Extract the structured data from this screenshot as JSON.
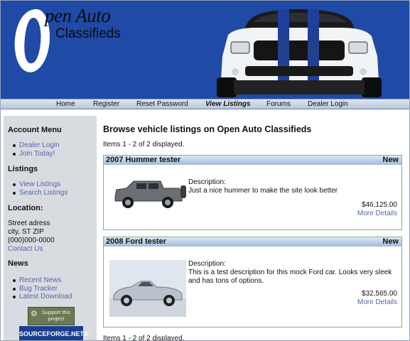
{
  "logo": {
    "line1": "pen Auto",
    "line2": "Classifieds"
  },
  "nav": {
    "items": [
      "Home",
      "Register",
      "Reset Password",
      "View Listings",
      "Forums",
      "Dealer Login"
    ],
    "active": "View Listings"
  },
  "sidebar": {
    "account_heading": "Account Menu",
    "account_links": [
      "Dealer Login",
      "Join Today!"
    ],
    "listings_heading": "Listings",
    "listings_links": [
      "View Listings",
      "Search Listings"
    ],
    "location_heading": "Location:",
    "address": [
      "Street adress",
      "city, ST ZIP",
      "(000)000-0000"
    ],
    "contact_link": "Contact Us",
    "news_heading": "News",
    "news_links": [
      "Recent News",
      "Bug Tracker",
      "Latest Download"
    ],
    "support_badge": "Support this project",
    "sourceforge_badge": "SOURCEFORGE.NET®"
  },
  "main": {
    "title": "Browse vehicle listings on Open Auto Classifieds",
    "count_top": "Items 1 - 2 of 2 displayed.",
    "count_bottom": "Items 1 - 2 of 2 displayed.",
    "listings": [
      {
        "title": "2007 Hummer tester",
        "badge": "New",
        "description_label": "Description:",
        "description": "Just a nice hummer to make the site look better",
        "price": "$46,125.00",
        "more": "More Details"
      },
      {
        "title": "2008 Ford tester",
        "badge": "New",
        "description_label": "Description:",
        "description": "This is a test description for this mock Ford car. Looks very sleek and has tons of options.",
        "price": "$32,565.00",
        "more": "More Details"
      }
    ]
  },
  "colors": {
    "header_bg": "#1f4aa6",
    "link": "#5567a8",
    "sidebar_bg": "#d8dbe0",
    "listing_border": "#8ab08a"
  }
}
